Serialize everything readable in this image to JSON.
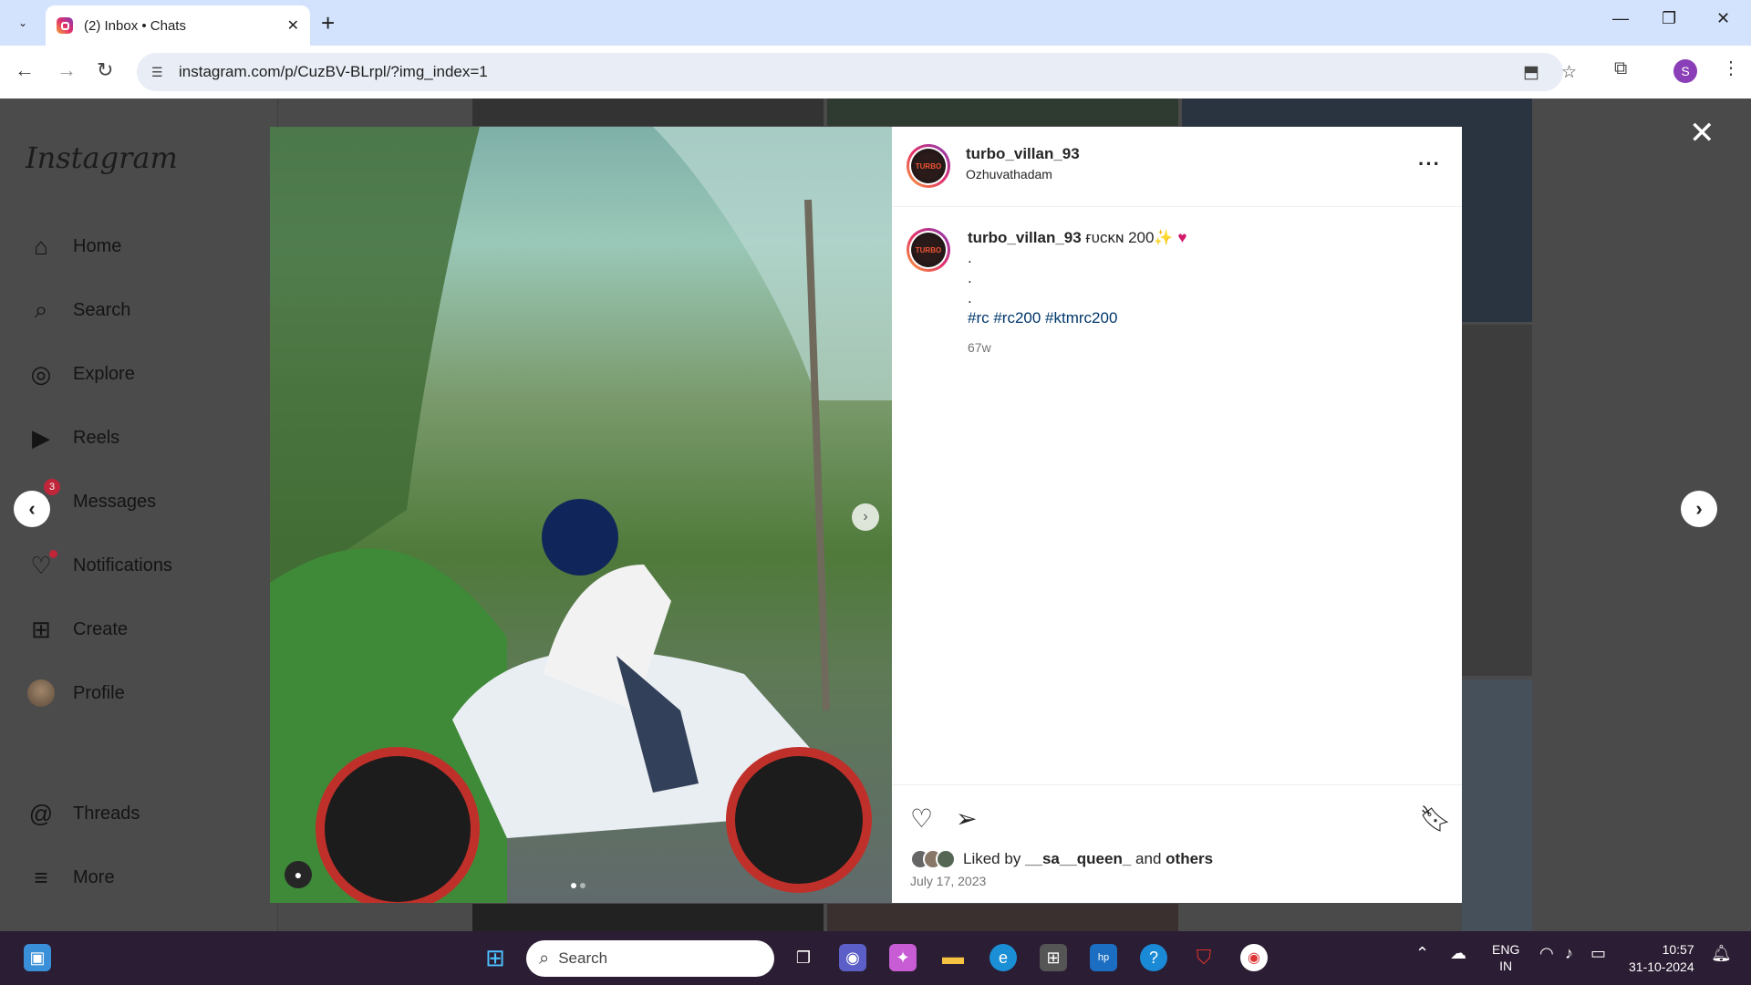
{
  "browser": {
    "tab_title": "(2) Inbox • Chats",
    "url": "instagram.com/p/CuzBV-BLrpl/?img_index=1",
    "profile_initial": "S",
    "window_controls": [
      "—",
      "❐",
      "✕"
    ]
  },
  "sidebar": {
    "logo": "Instagram",
    "items": [
      {
        "label": "Home",
        "icon": "⌂"
      },
      {
        "label": "Search",
        "icon": "⌕"
      },
      {
        "label": "Explore",
        "icon": "◎"
      },
      {
        "label": "Reels",
        "icon": "▶"
      },
      {
        "label": "Messages",
        "icon": "✈",
        "badge": "3"
      },
      {
        "label": "Notifications",
        "icon": "♡"
      },
      {
        "label": "Create",
        "icon": "⊞"
      },
      {
        "label": "Profile",
        "icon": ""
      },
      {
        "label": "Threads",
        "icon": "@"
      },
      {
        "label": "More",
        "icon": "≡"
      }
    ]
  },
  "post": {
    "username": "turbo_villan_93",
    "location": "Ozhuvathadam",
    "avatar_text": "TURBO",
    "caption_text": "ғᴜᴄᴋɴ 200✨",
    "caption_lines": [
      ".",
      ".",
      "."
    ],
    "hashtags": "#rc #rc200 #ktmrc200",
    "age": "67w",
    "liked_by_prefix": "Liked by",
    "liked_by_user": "__sa__queen_",
    "liked_by_and": "and",
    "liked_by_others": "others",
    "date": "July 17, 2023"
  },
  "taskbar": {
    "search_placeholder": "Search",
    "lang_top": "ENG",
    "lang_bottom": "IN",
    "time": "10:57",
    "date": "31-10-2024"
  },
  "colors": {
    "chrome_titlebar": "#d3e3fd",
    "overlay_bg": "#4a4a4a",
    "taskbar": "#2b1d33",
    "link": "#00376b"
  }
}
